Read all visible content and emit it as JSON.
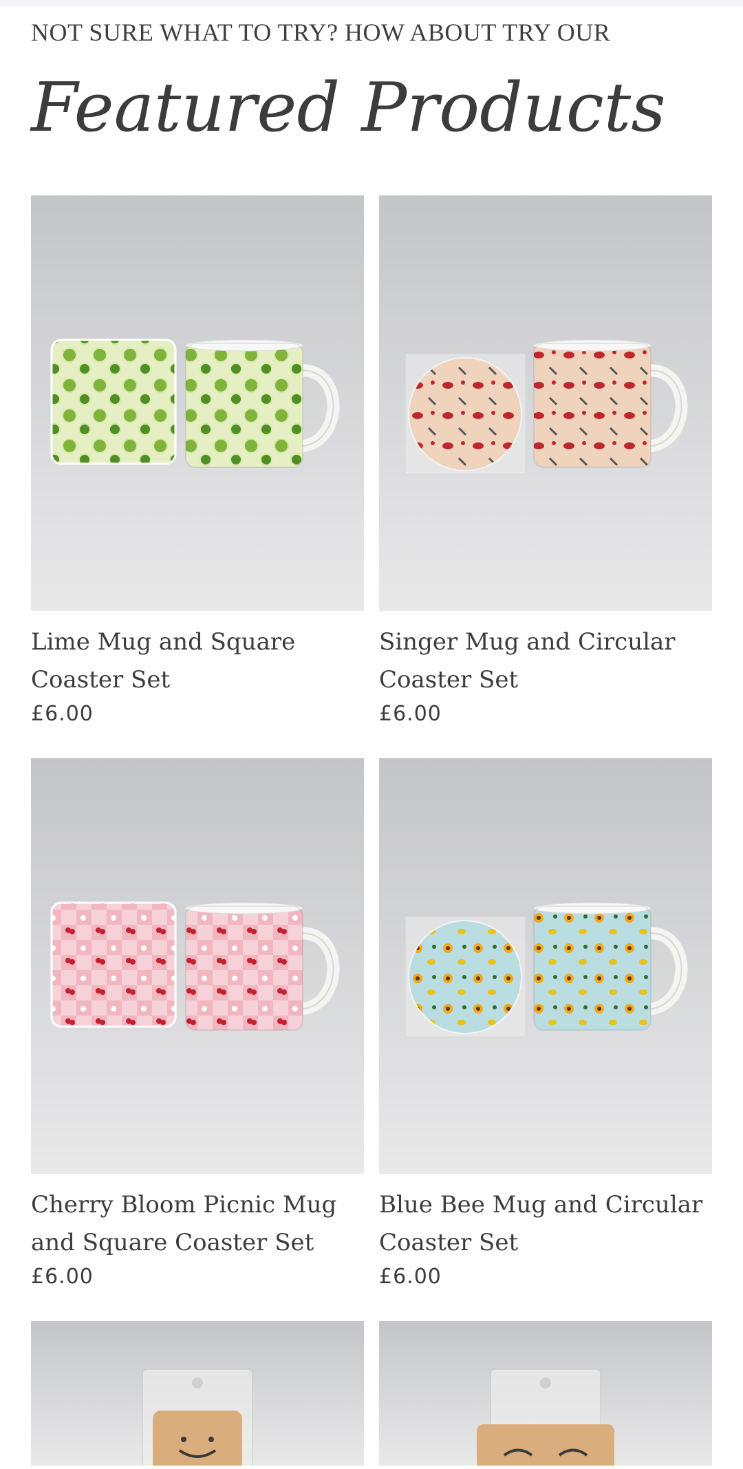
{
  "section": {
    "kicker": "NOT SURE WHAT TO TRY? HOW ABOUT TRY OUR",
    "heading": "Featured Products"
  },
  "products": [
    {
      "title": "Lime Mug and Square Coaster Set",
      "price": "£6.00",
      "image": {
        "theme": "lime",
        "base": "#e6efc4",
        "accent": "#7fb33a",
        "dot": "#4f8f25",
        "coaster_shape": "square"
      }
    },
    {
      "title": "Singer Mug and Circular Coaster Set",
      "price": "£6.00",
      "image": {
        "theme": "singer",
        "base": "#efd3bd",
        "accent": "#c0262d",
        "dot": "#555555",
        "coaster_shape": "circle"
      }
    },
    {
      "title": "Cherry Bloom Picnic Mug and Square Coaster Set",
      "price": "£6.00",
      "image": {
        "theme": "cherry",
        "base": "#f1b6c0",
        "accent": "#c3212f",
        "dot": "#ffffff",
        "coaster_shape": "square"
      }
    },
    {
      "title": "Blue Bee Mug and Circular Coaster Set",
      "price": "£6.00",
      "image": {
        "theme": "bee",
        "base": "#b9dde1",
        "accent": "#f2a91d",
        "dot": "#2f6d2b",
        "coaster_shape": "circle"
      }
    },
    {
      "title": "",
      "price": "",
      "image": {
        "theme": "keyring",
        "base": "#d9ad7c",
        "accent": "#b98a57",
        "dot": "#3a3a3a",
        "coaster_shape": "tag"
      }
    },
    {
      "title": "",
      "price": "",
      "image": {
        "theme": "keyring",
        "base": "#d9ad7c",
        "accent": "#b98a57",
        "dot": "#3a3a3a",
        "coaster_shape": "rect"
      }
    }
  ],
  "colors": {
    "background": "#ffffff",
    "photo_backdrop": "#c9c9cc",
    "text": "#3c3c3c"
  }
}
